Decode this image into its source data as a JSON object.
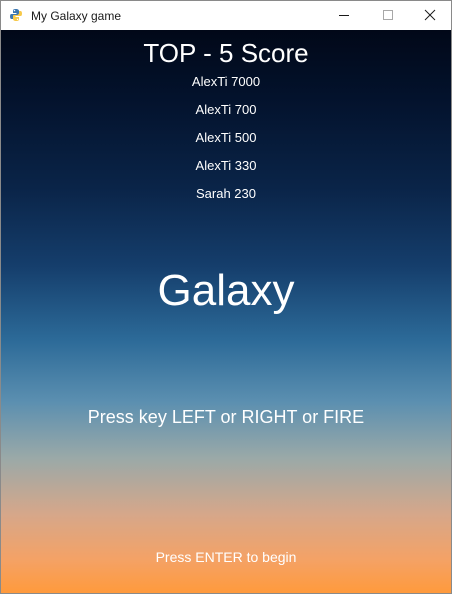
{
  "window": {
    "title": "My Galaxy game",
    "icon": "python-icon"
  },
  "game": {
    "scores_title": "TOP - 5 Score",
    "scores": [
      "AlexTi 7000",
      "AlexTi 700",
      "AlexTi 500",
      "AlexTi 330",
      "Sarah 230"
    ],
    "title": "Galaxy",
    "controls_hint": "Press key LEFT or RIGHT or FIRE",
    "start_hint": "Press ENTER to begin"
  },
  "colors": {
    "sky_top": "#010818",
    "sky_middle": "#2c6a98",
    "sky_bottom": "#ff9a3c",
    "text": "#ffffff"
  }
}
